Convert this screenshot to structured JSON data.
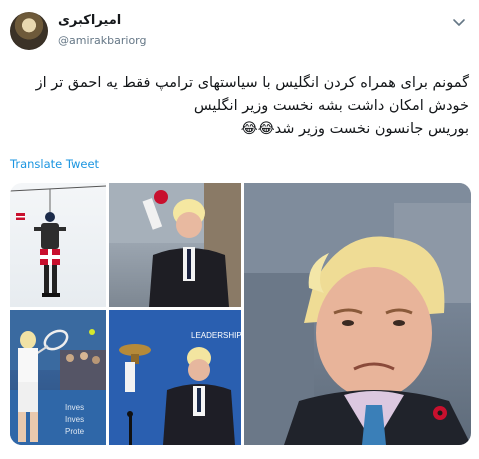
{
  "tweet": {
    "display_name": "امیراکبری",
    "handle": "@amirakbariorg",
    "body_lines": [
      "گمونم برای همراه کردن انگلیس با سیاستهای ترامپ فقط یه احمق تر از",
      "خودش امکان داشت بشه نخست وزیر انگلیس",
      "بوریس جانسون نخست وزیر شد😂😂"
    ],
    "translate_label": "Translate Tweet"
  },
  "icons": {
    "caret": "chevron-down-icon"
  },
  "colors": {
    "link": "#1b95e0",
    "secondary_text": "#657786",
    "primary_text": "#14171a"
  }
}
